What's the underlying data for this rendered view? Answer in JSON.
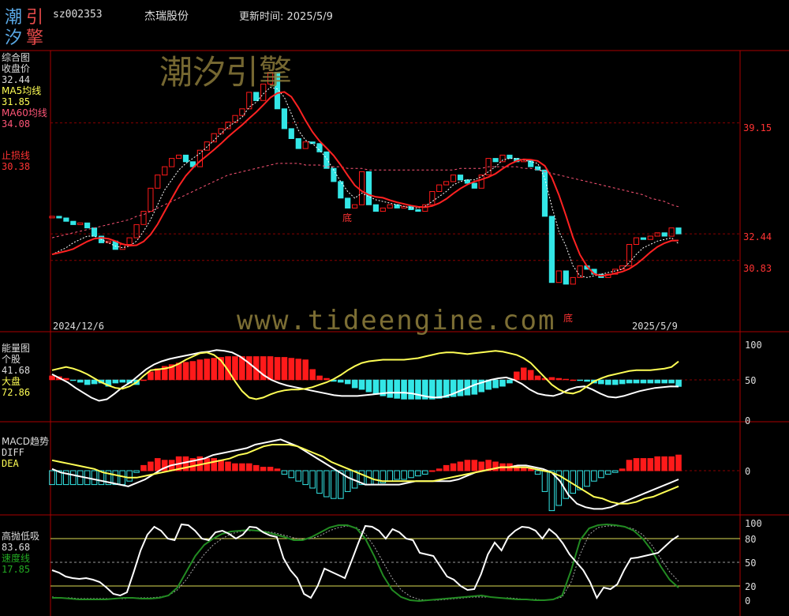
{
  "logo": {
    "chars": [
      "潮",
      "引",
      "汐",
      "擎"
    ]
  },
  "header": {
    "code": "sz002353",
    "name": "杰瑞股份",
    "update_label": "更新时间: 2025/5/9"
  },
  "watermark": {
    "top": "潮汐引擎",
    "url": "www.tideengine.com"
  },
  "colors": {
    "up": "#ff1a1a",
    "down": "#33e6e6",
    "ma5": "#ffff55",
    "ma60": "#ff5577",
    "stop": "#ff2222",
    "grid": "#880000",
    "k": "#ffffff",
    "d": "#ffff55",
    "speed": "#228b22"
  },
  "panels": {
    "main": {
      "title": "综合图",
      "close_label": "收盘价",
      "close_value": "32.44",
      "ma5_label": "MA5均线",
      "ma5_value": "31.85",
      "ma60_label": "MA60均线",
      "ma60_value": "34.08",
      "stop_label": "止损线",
      "stop_value": "30.38",
      "date_start": "2024/12/6",
      "date_end": "2025/5/9",
      "price_ticks": [
        "39.15",
        "32.44",
        "30.83"
      ],
      "bottom_marks": [
        "底",
        "底"
      ]
    },
    "energy": {
      "title": "能量图",
      "stock_label": "个股",
      "stock_value": "41.68",
      "market_label": "大盘",
      "market_value": "72.86",
      "ticks": [
        "100",
        "50",
        "0"
      ]
    },
    "macd": {
      "title": "MACD趋势",
      "diff_label": "DIFF",
      "dea_label": "DEA",
      "ticks": [
        "0"
      ]
    },
    "gaoxi": {
      "title": "高抛低吸",
      "value": "83.68",
      "speed_label": "速度线",
      "speed_value": "17.85",
      "ticks": [
        "100",
        "80",
        "50",
        "20",
        "0"
      ]
    }
  },
  "chart_data": [
    {
      "type": "candlestick",
      "dates": [
        "2024/12/6",
        "2025/5/9"
      ],
      "close": [
        33.5,
        33.4,
        33.2,
        33.0,
        33.1,
        32.8,
        32.3,
        31.9,
        32.0,
        31.5,
        31.8,
        32.2,
        33.0,
        33.8,
        35.2,
        36.0,
        36.5,
        37.0,
        37.2,
        36.8,
        36.5,
        37.5,
        38.0,
        38.5,
        38.8,
        39.2,
        39.6,
        40.0,
        41.0,
        40.5,
        41.5,
        42.2,
        40.0,
        38.8,
        38.2,
        37.6,
        38.0,
        37.9,
        37.4,
        36.4,
        35.6,
        34.6,
        34.0,
        34.2,
        36.2,
        34.2,
        33.8,
        34.0,
        34.2,
        34.0,
        34.1,
        33.9,
        33.8,
        34.2,
        35.0,
        35.4,
        35.6,
        36.0,
        35.7,
        35.5,
        35.2,
        36.0,
        37.0,
        36.8,
        37.2,
        37.0,
        36.8,
        36.9,
        36.5,
        36.3,
        33.5,
        29.5,
        30.2,
        29.4,
        29.8,
        30.5,
        30.3,
        30.0,
        29.8,
        30.0,
        30.3,
        30.5,
        31.8,
        32.2,
        32.1,
        32.3,
        32.5,
        32.3,
        32.8,
        32.44
      ],
      "ma5": [
        31.2,
        31.4,
        31.6,
        31.9,
        32.1,
        32.3,
        32.3,
        32.1,
        31.9,
        31.7,
        31.6,
        31.7,
        32.0,
        32.6,
        33.3,
        34.2,
        35.1,
        35.7,
        36.3,
        36.7,
        37.0,
        37.3,
        37.7,
        38.1,
        38.5,
        38.9,
        39.2,
        39.5,
        40.1,
        40.4,
        40.9,
        41.3,
        41.2,
        40.7,
        39.7,
        38.7,
        38.1,
        37.9,
        37.5,
        37.0,
        36.3,
        35.6,
        35.0,
        34.6,
        34.9,
        34.7,
        34.5,
        34.4,
        34.3,
        34.2,
        34.1,
        34.0,
        34.0,
        34.1,
        34.4,
        34.7,
        35.0,
        35.4,
        35.6,
        35.7,
        35.7,
        35.9,
        36.2,
        36.5,
        36.9,
        37.0,
        37.0,
        36.9,
        36.8,
        36.7,
        35.8,
        34.1,
        32.6,
        31.7,
        30.5,
        29.9,
        29.8,
        29.9,
        30.0,
        30.1,
        30.2,
        30.3,
        30.7,
        31.2,
        31.6,
        31.8,
        32.0,
        32.1,
        32.2,
        31.85
      ],
      "ma60": [
        32.2,
        32.3,
        32.4,
        32.5,
        32.6,
        32.7,
        32.8,
        32.9,
        33.0,
        33.1,
        33.2,
        33.3,
        33.5,
        33.6,
        33.8,
        34.0,
        34.2,
        34.4,
        34.6,
        34.8,
        35.0,
        35.2,
        35.4,
        35.6,
        35.8,
        36.0,
        36.1,
        36.2,
        36.3,
        36.4,
        36.5,
        36.6,
        36.7,
        36.7,
        36.7,
        36.7,
        36.6,
        36.6,
        36.6,
        36.5,
        36.5,
        36.5,
        36.4,
        36.4,
        36.4,
        36.3,
        36.3,
        36.3,
        36.3,
        36.3,
        36.3,
        36.3,
        36.3,
        36.3,
        36.3,
        36.3,
        36.3,
        36.3,
        36.4,
        36.4,
        36.4,
        36.4,
        36.5,
        36.5,
        36.5,
        36.5,
        36.5,
        36.4,
        36.4,
        36.3,
        36.2,
        36.1,
        36.0,
        35.9,
        35.8,
        35.7,
        35.6,
        35.5,
        35.4,
        35.3,
        35.2,
        35.1,
        35.0,
        34.9,
        34.8,
        34.6,
        34.5,
        34.4,
        34.2,
        34.08
      ]
    },
    {
      "type": "bar",
      "name": "energy",
      "stock": [
        55,
        54,
        52,
        49,
        47,
        44,
        45,
        46,
        42,
        46,
        47,
        46,
        44,
        50,
        60,
        64,
        67,
        69,
        71,
        72,
        73,
        75,
        76,
        77,
        78,
        79,
        79,
        79,
        79,
        79,
        79,
        79,
        78,
        78,
        77,
        76,
        75,
        63,
        55,
        52,
        48,
        47,
        45,
        40,
        38,
        35,
        32,
        30,
        28,
        27,
        26,
        26,
        26,
        26,
        26,
        27,
        28,
        29,
        30,
        31,
        32,
        35,
        38,
        40,
        42,
        46,
        60,
        65,
        62,
        55,
        52,
        53,
        52,
        51,
        50,
        49,
        48,
        46,
        45,
        44,
        44,
        45,
        46,
        46,
        46,
        46,
        46,
        46,
        46,
        41.68
      ],
      "stock_line": [
        57,
        52,
        47,
        40,
        34,
        28,
        24,
        26,
        33,
        41,
        47,
        55,
        63,
        69,
        73,
        76,
        78,
        80,
        82,
        84,
        85,
        87,
        86,
        84,
        79,
        72,
        64,
        56,
        50,
        46,
        43,
        41,
        39,
        37,
        35,
        33,
        31,
        30,
        30,
        30,
        31,
        32,
        33,
        34,
        34,
        34,
        33,
        31,
        29,
        28,
        29,
        32,
        36,
        40,
        44,
        47,
        50,
        52,
        53,
        50,
        45,
        38,
        33,
        31,
        30,
        33,
        38,
        41,
        42,
        38,
        33,
        29,
        28,
        30,
        33,
        36,
        38,
        40,
        41,
        42,
        41.68
      ],
      "market_line": [
        62,
        64,
        66,
        64,
        61,
        57,
        52,
        47,
        43,
        40,
        39,
        42,
        47,
        55,
        62,
        63,
        64,
        66,
        70,
        75,
        79,
        83,
        84,
        81,
        74,
        62,
        48,
        36,
        28,
        26,
        28,
        32,
        35,
        37,
        38,
        38,
        39,
        41,
        44,
        47,
        51,
        56,
        62,
        67,
        71,
        73,
        74,
        75,
        75,
        75,
        75,
        76,
        77,
        79,
        81,
        83,
        84,
        84,
        83,
        82,
        83,
        84,
        85,
        86,
        85,
        83,
        81,
        77,
        71,
        62,
        53,
        44,
        38,
        34,
        33,
        36,
        42,
        48,
        52,
        55,
        57,
        59,
        61,
        62,
        62,
        62,
        63,
        64,
        66,
        72.86
      ]
    },
    {
      "type": "bar",
      "name": "macd",
      "macd": [
        -0.8,
        -0.8,
        -0.8,
        -0.8,
        -0.8,
        -0.8,
        -0.8,
        -0.8,
        -0.8,
        -0.8,
        -0.8,
        -0.6,
        -0.1,
        0.3,
        0.5,
        0.7,
        0.6,
        0.6,
        0.8,
        0.8,
        0.7,
        0.8,
        0.7,
        0.7,
        0.6,
        0.5,
        0.4,
        0.4,
        0.4,
        0.3,
        0.2,
        0.2,
        0.1,
        -0.2,
        -0.4,
        -0.6,
        -0.8,
        -1.0,
        -1.3,
        -1.5,
        -1.6,
        -1.6,
        -1.2,
        -1.0,
        -0.8,
        -0.8,
        -0.8,
        -0.7,
        -0.6,
        -0.5,
        -0.5,
        -0.4,
        -0.3,
        -0.2,
        0.0,
        0.1,
        0.3,
        0.4,
        0.5,
        0.6,
        0.6,
        0.5,
        0.6,
        0.5,
        0.4,
        0.4,
        0.3,
        0.2,
        0.1,
        -0.2,
        -1.2,
        -2.3,
        -2.0,
        -1.6,
        -1.3,
        -1.1,
        -0.9,
        -0.6,
        -0.4,
        -0.2,
        -0.1,
        0.1,
        0.6,
        0.7,
        0.7,
        0.7,
        0.8,
        0.8,
        0.8,
        0.9
      ],
      "diff": [
        0.1,
        -0.1,
        -0.2,
        -0.3,
        -0.4,
        -0.5,
        -0.6,
        -0.7,
        -0.8,
        -0.9,
        -0.7,
        -0.5,
        -0.2,
        0.1,
        0.3,
        0.4,
        0.5,
        0.6,
        0.7,
        0.9,
        1.0,
        1.1,
        1.2,
        1.3,
        1.5,
        1.6,
        1.7,
        1.8,
        1.6,
        1.4,
        1.1,
        0.8,
        0.5,
        0.2,
        -0.1,
        -0.4,
        -0.6,
        -0.8,
        -0.8,
        -0.8,
        -0.8,
        -0.8,
        -0.7,
        -0.6,
        -0.6,
        -0.6,
        -0.6,
        -0.6,
        -0.5,
        -0.3,
        -0.1,
        0.0,
        0.1,
        0.2,
        0.2,
        0.3,
        0.3,
        0.2,
        0.1,
        -0.1,
        -0.6,
        -1.4,
        -1.9,
        -2.1,
        -2.2,
        -2.2,
        -2.1,
        -1.9,
        -1.7,
        -1.5,
        -1.3,
        -1.1,
        -0.9,
        -0.7,
        -0.5
      ],
      "dea": [
        0.6,
        0.5,
        0.4,
        0.3,
        0.2,
        0.1,
        -0.1,
        -0.2,
        -0.3,
        -0.4,
        -0.4,
        -0.3,
        -0.2,
        -0.1,
        0.0,
        0.1,
        0.2,
        0.3,
        0.4,
        0.5,
        0.6,
        0.7,
        0.9,
        1.0,
        1.2,
        1.4,
        1.5,
        1.5,
        1.5,
        1.4,
        1.2,
        1.0,
        0.8,
        0.5,
        0.3,
        0.1,
        -0.1,
        -0.3,
        -0.5,
        -0.6,
        -0.6,
        -0.6,
        -0.6,
        -0.6,
        -0.6,
        -0.6,
        -0.5,
        -0.4,
        -0.3,
        -0.2,
        -0.1,
        0.0,
        0.1,
        0.2,
        0.2,
        0.2,
        0.2,
        0.1,
        0.0,
        -0.1,
        -0.3,
        -0.6,
        -0.9,
        -1.2,
        -1.5,
        -1.6,
        -1.8,
        -1.9,
        -1.9,
        -1.8,
        -1.6,
        -1.5,
        -1.3,
        -1.1,
        -0.9
      ]
    },
    {
      "type": "line",
      "name": "gaoxi",
      "ylim": [
        0,
        100
      ],
      "value": [
        40,
        37,
        32,
        30,
        29,
        30,
        28,
        25,
        18,
        10,
        8,
        12,
        38,
        65,
        85,
        95,
        90,
        80,
        78,
        98,
        97,
        90,
        80,
        78,
        88,
        90,
        86,
        80,
        85,
        95,
        94,
        88,
        84,
        82,
        55,
        40,
        30,
        10,
        5,
        20,
        42,
        38,
        34,
        30,
        52,
        75,
        96,
        95,
        90,
        80,
        92,
        88,
        80,
        78,
        62,
        60,
        58,
        45,
        32,
        28,
        20,
        15,
        16,
        35,
        60,
        75,
        65,
        82,
        90,
        95,
        94,
        90,
        80,
        92,
        85,
        74,
        60,
        50,
        40,
        25,
        5,
        18,
        16,
        22,
        40,
        55,
        56,
        58,
        60,
        62,
        70,
        78,
        83.68
      ],
      "speed": [
        5,
        5,
        4,
        3,
        3,
        3,
        3,
        4,
        5,
        5,
        4,
        4,
        5,
        8,
        18,
        38,
        58,
        72,
        80,
        86,
        89,
        90,
        91,
        90,
        88,
        85,
        82,
        78,
        78,
        82,
        88,
        94,
        97,
        97,
        93,
        80,
        58,
        33,
        15,
        6,
        2,
        1,
        2,
        3,
        4,
        5,
        6,
        7,
        8,
        6,
        5,
        4,
        3,
        3,
        2,
        2,
        3,
        8,
        40,
        78,
        93,
        97,
        98,
        97,
        95,
        90,
        80,
        65,
        45,
        28,
        17.85
      ],
      "speed_ma": [
        6,
        5,
        5,
        4,
        4,
        4,
        4,
        4,
        4,
        5,
        5,
        5,
        6,
        8,
        15,
        28,
        45,
        60,
        72,
        80,
        86,
        89,
        90,
        90,
        89,
        87,
        84,
        81,
        79,
        80,
        84,
        90,
        94,
        96,
        94,
        86,
        70,
        50,
        30,
        15,
        7,
        3,
        2,
        2,
        3,
        4,
        5,
        6,
        6,
        6,
        5,
        5,
        4,
        3,
        3,
        2,
        3,
        6,
        25,
        60,
        85,
        94,
        96,
        96,
        95,
        92,
        85,
        72,
        55,
        38,
        26
      ]
    }
  ]
}
